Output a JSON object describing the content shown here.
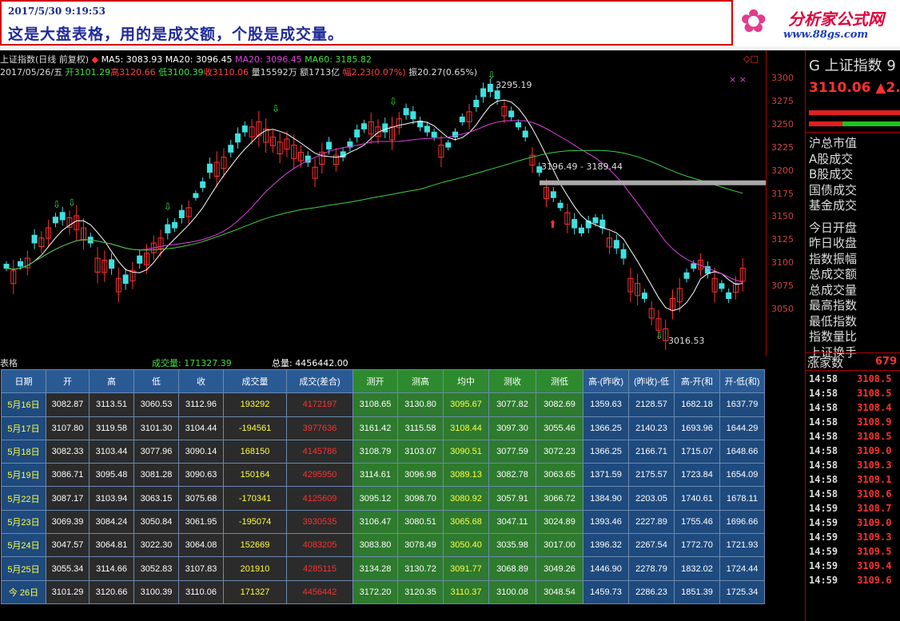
{
  "banner": {
    "timestamp": "2017/5/30 9:19:53",
    "message": "这是大盘表格，用的是成交额，个股是成交量。"
  },
  "logo": {
    "name": "分析家公式网",
    "url": "www.88gs.com"
  },
  "chart": {
    "title_line": "上证指数(日线 前复权)",
    "ma5": "MA5: 3083.93",
    "ma20": "MA20: 3096.45",
    "ma20b": "MA20: 3096.45",
    "ma60": "MA60: 3185.82",
    "date": "2017/05/26/五",
    "open": "开3101.29",
    "high": "高3120.66",
    "low": "低3100.39",
    "close": "收3110.06",
    "vol": "量15592万",
    "amt": "额1713亿",
    "amp": "幅2.23(0.07%)",
    "swing": "振20.27(0.65%)",
    "peak": "3295.19",
    "range": "3196.49 - 3189.44",
    "trough": "3016.53",
    "yticks": [
      "3300",
      "3275",
      "3250",
      "3225",
      "3200",
      "3175",
      "3150",
      "3125",
      "3100",
      "3075",
      "3050"
    ]
  },
  "chart_data": {
    "type": "line",
    "title": "上证指数(日线 前复权)",
    "ylim": [
      3025,
      3310
    ],
    "series": [
      {
        "name": "MA5",
        "values": [
          3083.93
        ]
      },
      {
        "name": "MA20",
        "values": [
          3096.45
        ]
      },
      {
        "name": "MA60",
        "values": [
          3185.82
        ]
      }
    ]
  },
  "table_bar": {
    "label": "表格",
    "vol": "成交量: 171327.39",
    "total": "总量: 4456442.00"
  },
  "table": {
    "headers": [
      "日期",
      "开",
      "高",
      "低",
      "收",
      "成交量",
      "成交(差合)",
      "测开",
      "测高",
      "均中",
      "测收",
      "测低",
      "高-(昨收)",
      "(昨收)-低",
      "高-开(和",
      "开-低(和)"
    ],
    "rows": [
      [
        "5月16日",
        "3082.87",
        "3113.51",
        "3060.53",
        "3112.96",
        "193292",
        "4172197",
        "3108.65",
        "3130.80",
        "3095.67",
        "3077.82",
        "3082.69",
        "1359.63",
        "2128.57",
        "1682.18",
        "1637.79"
      ],
      [
        "5月17日",
        "3107.80",
        "3119.58",
        "3101.30",
        "3104.44",
        "-194561",
        "3977636",
        "3161.42",
        "3115.58",
        "3108.44",
        "3097.30",
        "3055.46",
        "1366.25",
        "2140.23",
        "1693.96",
        "1644.29"
      ],
      [
        "5月18日",
        "3082.33",
        "3103.44",
        "3077.96",
        "3090.14",
        "168150",
        "4145786",
        "3108.79",
        "3103.07",
        "3090.51",
        "3077.59",
        "3072.23",
        "1366.25",
        "2166.71",
        "1715.07",
        "1648.66"
      ],
      [
        "5月19日",
        "3086.71",
        "3095.48",
        "3081.28",
        "3090.63",
        "150164",
        "4295950",
        "3114.61",
        "3096.98",
        "3089.13",
        "3082.78",
        "3063.65",
        "1371.59",
        "2175.57",
        "1723.84",
        "1654.09"
      ],
      [
        "5月22日",
        "3087.17",
        "3103.94",
        "3063.15",
        "3075.68",
        "-170341",
        "4125609",
        "3095.12",
        "3098.70",
        "3080.92",
        "3057.91",
        "3066.72",
        "1384.90",
        "2203.05",
        "1740.61",
        "1678.11"
      ],
      [
        "5月23日",
        "3069.39",
        "3084.24",
        "3050.84",
        "3061.95",
        "-195074",
        "3930535",
        "3106.47",
        "3080.51",
        "3065.68",
        "3047.11",
        "3024.89",
        "1393.46",
        "2227.89",
        "1755.46",
        "1696.66"
      ],
      [
        "5月24日",
        "3047.57",
        "3064.81",
        "3022.30",
        "3064.08",
        "152669",
        "4083205",
        "3083.80",
        "3078.49",
        "3050.40",
        "3035.98",
        "3017.00",
        "1396.32",
        "2267.54",
        "1772.70",
        "1721.93"
      ],
      [
        "5月25日",
        "3055.34",
        "3114.66",
        "3052.83",
        "3107.83",
        "201910",
        "4285115",
        "3134.28",
        "3130.72",
        "3091.77",
        "3068.89",
        "3049.26",
        "1446.90",
        "2278.79",
        "1832.02",
        "1724.44"
      ],
      [
        "今 26日",
        "3101.29",
        "3120.66",
        "3100.39",
        "3110.06",
        "171327",
        "4456442",
        "3172.20",
        "3120.35",
        "3110.37",
        "3100.08",
        "3048.54",
        "1459.73",
        "2286.23",
        "1851.39",
        "1725.34"
      ]
    ]
  },
  "right_panel": {
    "title": "G 上证指数 9",
    "price": "3110.06",
    "change": "▲2.",
    "labels": [
      "沪总市值",
      "A股成交",
      "B股成交",
      "国债成交",
      "基金成交",
      "今日开盘",
      "昨日收盘",
      "指数振幅",
      "总成交额",
      "总成交量",
      "最高指数",
      "最低指数",
      "指数量比",
      "上证换手"
    ],
    "zhang": "涨家数",
    "zhang_val": "679",
    "ticks": [
      [
        "14:58",
        "3108.5"
      ],
      [
        "14:58",
        "3108.5"
      ],
      [
        "14:58",
        "3108.4"
      ],
      [
        "14:58",
        "3108.9"
      ],
      [
        "14:58",
        "3108.5"
      ],
      [
        "14:58",
        "3109.0"
      ],
      [
        "14:58",
        "3109.3"
      ],
      [
        "14:58",
        "3109.1"
      ],
      [
        "14:58",
        "3108.6"
      ],
      [
        "14:59",
        "3108.7"
      ],
      [
        "14:59",
        "3109.0"
      ],
      [
        "14:59",
        "3109.3"
      ],
      [
        "14:59",
        "3109.5"
      ],
      [
        "14:59",
        "3109.4"
      ],
      [
        "14:59",
        "3109.6"
      ]
    ]
  }
}
